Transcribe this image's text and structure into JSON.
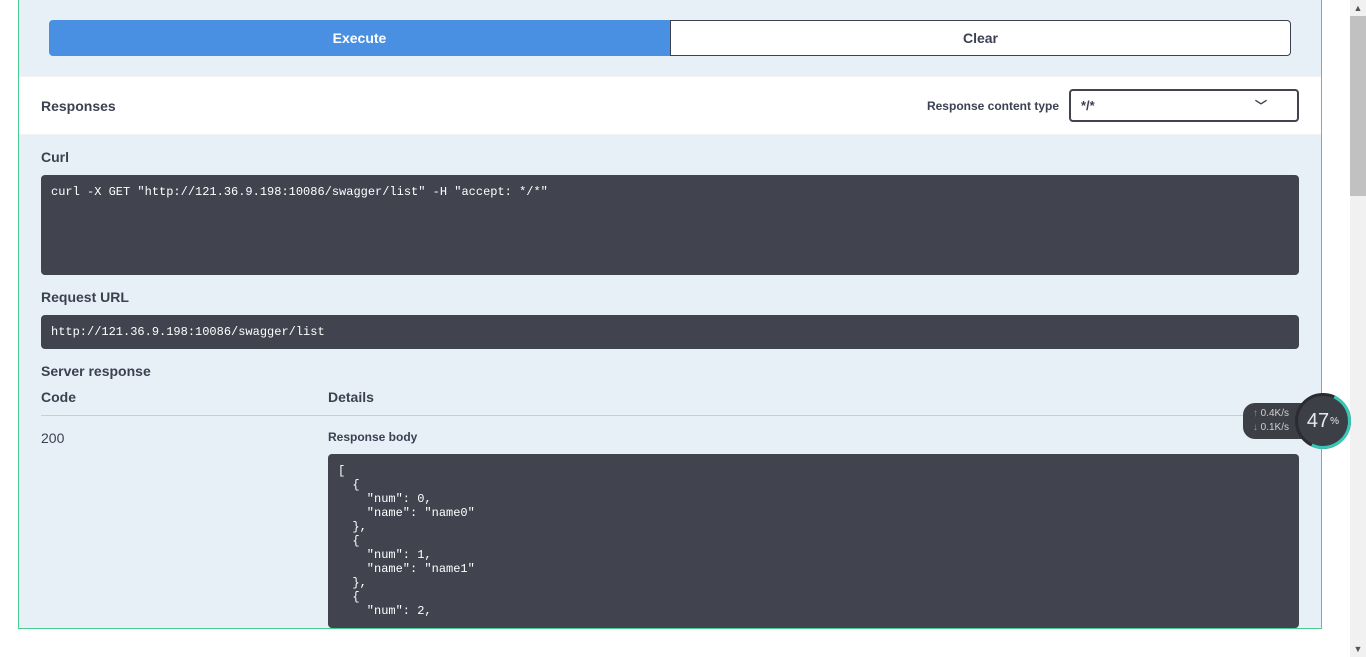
{
  "buttons": {
    "execute_label": "Execute",
    "clear_label": "Clear"
  },
  "responses": {
    "title": "Responses",
    "content_type_label": "Response content type",
    "content_type_value": "*/*"
  },
  "curl": {
    "label": "Curl",
    "command": "curl -X GET \"http://121.36.9.198:10086/swagger/list\" -H \"accept: */*\""
  },
  "request_url": {
    "label": "Request URL",
    "value": "http://121.36.9.198:10086/swagger/list"
  },
  "server_response": {
    "label": "Server response",
    "headers": {
      "code": "Code",
      "details": "Details"
    },
    "code": "200",
    "response_body_label": "Response body",
    "response_body": "[\n  {\n    \"num\": 0,\n    \"name\": \"name0\"\n  },\n  {\n    \"num\": 1,\n    \"name\": \"name1\"\n  },\n  {\n    \"num\": 2,"
  },
  "net_widget": {
    "up": "0.4K/s",
    "down": "0.1K/s",
    "percent": "47",
    "percent_suffix": "%"
  }
}
